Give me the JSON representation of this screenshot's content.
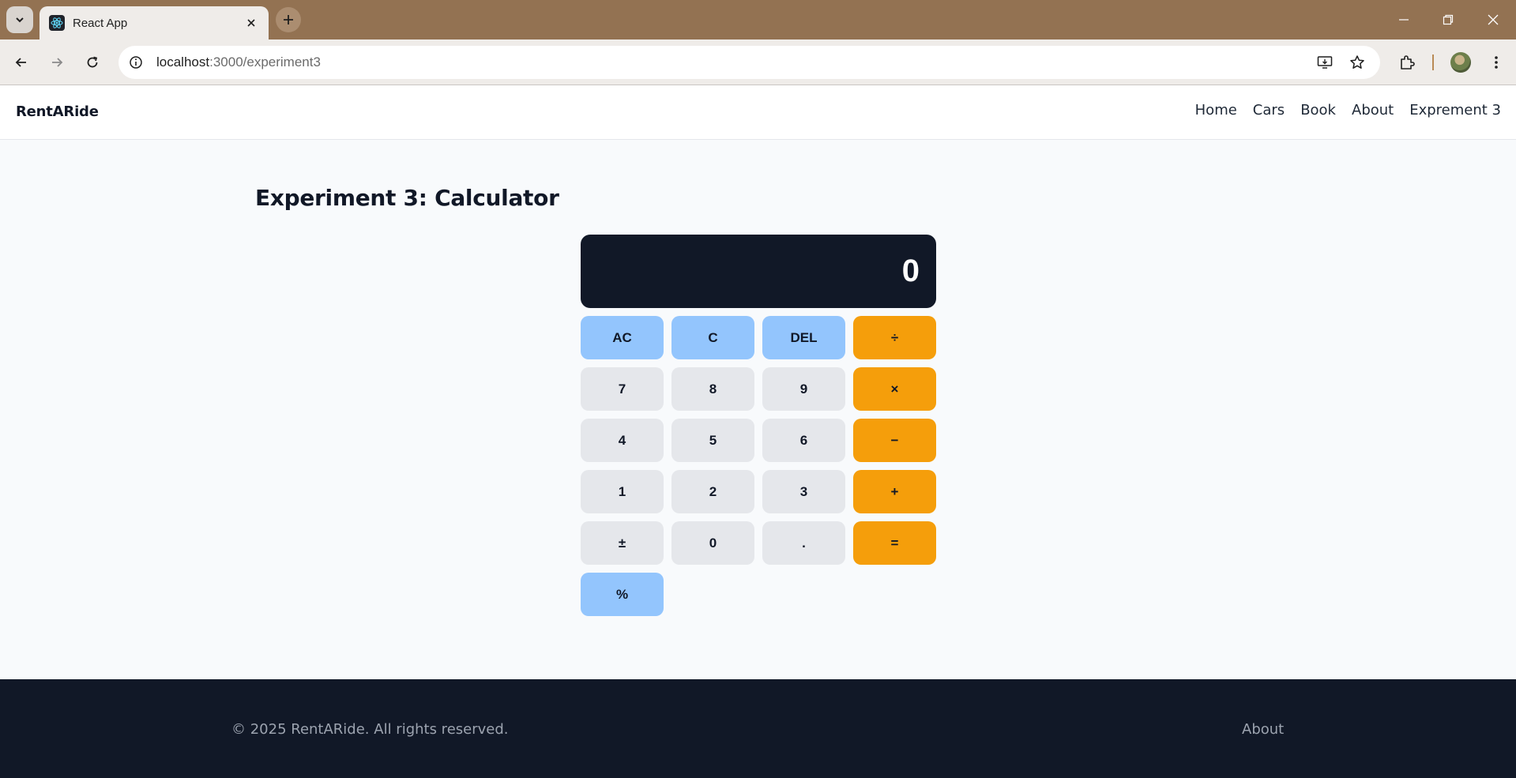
{
  "browser": {
    "tab_title": "React App",
    "url_host": "localhost",
    "url_rest": ":3000/experiment3",
    "icons": [
      "tab-search-icon",
      "react-favicon-icon",
      "close-icon",
      "plus-icon",
      "minimize-icon",
      "restore-icon",
      "window-close-icon",
      "back-arrow-icon",
      "forward-arrow-icon",
      "reload-icon",
      "site-info-icon",
      "install-app-icon",
      "star-icon",
      "extensions-icon",
      "kebab-menu-icon"
    ]
  },
  "header": {
    "brand": "RentARide",
    "nav": [
      "Home",
      "Cars",
      "Book",
      "About",
      "Exprement 3"
    ]
  },
  "main": {
    "title": "Experiment 3: Calculator",
    "calculator": {
      "display": "0",
      "keys": [
        {
          "label": "AC",
          "kind": "fn"
        },
        {
          "label": "C",
          "kind": "fn"
        },
        {
          "label": "DEL",
          "kind": "fn"
        },
        {
          "label": "÷",
          "kind": "op"
        },
        {
          "label": "7",
          "kind": "num"
        },
        {
          "label": "8",
          "kind": "num"
        },
        {
          "label": "9",
          "kind": "num"
        },
        {
          "label": "×",
          "kind": "op"
        },
        {
          "label": "4",
          "kind": "num"
        },
        {
          "label": "5",
          "kind": "num"
        },
        {
          "label": "6",
          "kind": "num"
        },
        {
          "label": "−",
          "kind": "op"
        },
        {
          "label": "1",
          "kind": "num"
        },
        {
          "label": "2",
          "kind": "num"
        },
        {
          "label": "3",
          "kind": "num"
        },
        {
          "label": "+",
          "kind": "op"
        },
        {
          "label": "±",
          "kind": "num"
        },
        {
          "label": "0",
          "kind": "num"
        },
        {
          "label": ".",
          "kind": "num"
        },
        {
          "label": "=",
          "kind": "op"
        },
        {
          "label": "%",
          "kind": "fn"
        }
      ]
    }
  },
  "footer": {
    "copyright": "© 2025 RentARide. All rights reserved.",
    "link": "About"
  },
  "colors": {
    "tabstrip": "#937252",
    "display_bg": "#111827",
    "fn_key": "#93c5fd",
    "num_key": "#e5e7eb",
    "op_key": "#f59e0b",
    "footer_bg": "#111827"
  }
}
